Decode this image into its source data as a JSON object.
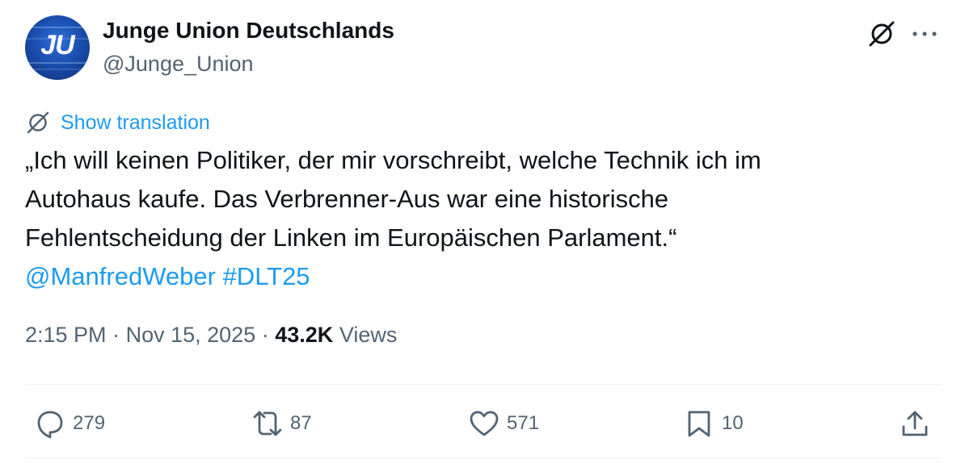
{
  "author": {
    "avatar_text": "JU",
    "display_name": "Junge Union Deutschlands",
    "handle": "@Junge_Union"
  },
  "header_icons": {
    "translate": "translate-icon",
    "more": "more-dots-icon"
  },
  "translation": {
    "label": "Show translation",
    "icon": "translate-icon"
  },
  "tweet": {
    "lines": [
      "„Ich will keinen Politiker, der mir vorschreibt, welche Technik ich im",
      "Autohaus kaufe. Das Verbrenner-Aus war eine historische",
      "Fehlentscheidung der Linken im Europäischen Parlament.“"
    ],
    "mention": "@ManfredWeber",
    "hashtag": "#DLT25"
  },
  "meta": {
    "time": "2:15 PM",
    "separator": "·",
    "date": "Nov 15, 2025",
    "views_count": "43.2K",
    "views_label": "Views"
  },
  "actions": {
    "replies": {
      "icon": "reply-icon",
      "count": "279"
    },
    "reposts": {
      "icon": "repost-icon",
      "count": "87"
    },
    "likes": {
      "icon": "like-icon",
      "count": "571"
    },
    "bookmarks": {
      "icon": "bookmark-icon",
      "count": "10"
    },
    "share": {
      "icon": "share-icon"
    }
  },
  "colors": {
    "link": "#1d9bf0",
    "text": "#0f1419",
    "secondary": "#536471",
    "divider": "#eff3f4"
  }
}
